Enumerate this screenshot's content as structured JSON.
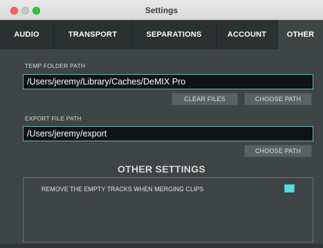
{
  "window": {
    "title": "Settings"
  },
  "tabs": [
    {
      "label": "AUDIO",
      "active": false
    },
    {
      "label": "TRANSPORT",
      "active": false
    },
    {
      "label": "SEPARATIONS",
      "active": false
    },
    {
      "label": "ACCOUNT",
      "active": false
    },
    {
      "label": "OTHER",
      "active": true
    }
  ],
  "temp_folder": {
    "label": "TEMP FOLDER PATH",
    "value": "/Users/jeremy/Library/Caches/DeMIX Pro",
    "clear_button": "CLEAR FILES",
    "choose_button": "CHOOSE PATH"
  },
  "export_path": {
    "label": "EXPORT FILE PATH",
    "value": "/Users/jeremy/export",
    "choose_button": "CHOOSE PATH"
  },
  "other_settings": {
    "heading": "OTHER SETTINGS",
    "items": [
      {
        "label": "REMOVE THE EMPTY TRACKS WHEN MERGING CLIPS",
        "checked": true
      }
    ]
  },
  "colors": {
    "accent": "#5ed7e4",
    "field_border": "#5fb7b9",
    "tab_bar": "#2b3031",
    "panel": "#3f4444"
  }
}
